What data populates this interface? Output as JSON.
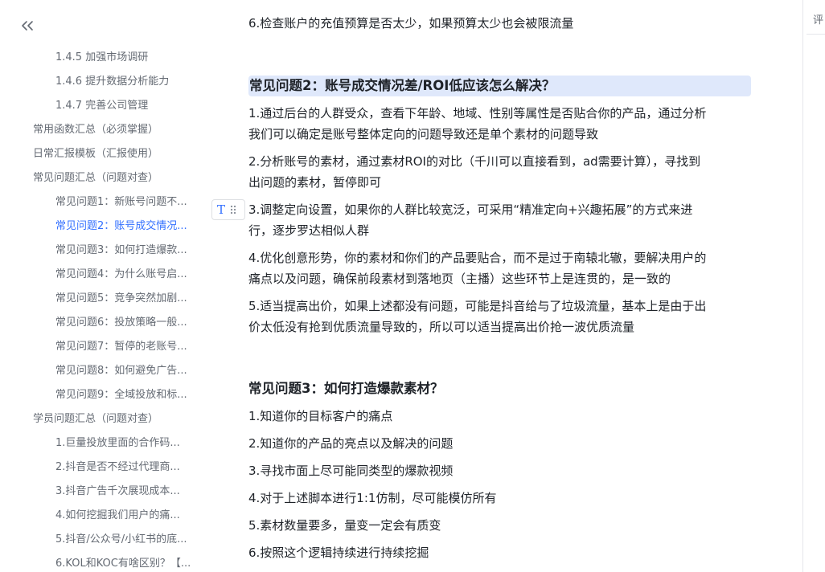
{
  "toc": {
    "items": [
      {
        "label": "1.4.5 加强市场调研",
        "level": 3
      },
      {
        "label": "1.4.6 提升数据分析能力",
        "level": 3
      },
      {
        "label": "1.4.7 完善公司管理",
        "level": 3
      },
      {
        "label": "常用函数汇总（必须掌握）",
        "level": 2
      },
      {
        "label": "日常汇报模板（汇报使用）",
        "level": 2
      },
      {
        "label": "常见问题汇总（问题对查）",
        "level": 2
      },
      {
        "label": "常见问题1：新账号问题不...",
        "level": 3
      },
      {
        "label": "常见问题2：账号成交情况...",
        "level": 3,
        "active": true
      },
      {
        "label": "常见问题3：如何打造爆款...",
        "level": 3
      },
      {
        "label": "常见问题4：为什么账号启...",
        "level": 3
      },
      {
        "label": "常见问题5：竞争突然加剧...",
        "level": 3
      },
      {
        "label": "常见问题6：投放策略一般...",
        "level": 3
      },
      {
        "label": "常见问题7：暂停的老账号...",
        "level": 3
      },
      {
        "label": "常见问题8：如何避免广告...",
        "level": 3
      },
      {
        "label": "常见问题9：全域投放和标...",
        "level": 3
      },
      {
        "label": "学员问题汇总（问题对查）",
        "level": 2
      },
      {
        "label": "1.巨量投放里面的合作码...",
        "level": 3
      },
      {
        "label": "2.抖音是否不经过代理商...",
        "level": 3
      },
      {
        "label": "3.抖音广告千次展现成本...",
        "level": 3
      },
      {
        "label": "4.如何挖掘我们用户的痛...",
        "level": 3
      },
      {
        "label": "5.抖音/公众号/小红书的底...",
        "level": 3
      },
      {
        "label": "6.KOL和KOC有啥区别？【...",
        "level": 3
      }
    ]
  },
  "block_tool": {
    "type_glyph": "T"
  },
  "doc": {
    "top_line": "6.检查账户的充值预算是否太少，如果预算太少也会被限流量",
    "q2_heading": "常见问题2：账号成交情况差/ROI低应该怎么解决？",
    "q2_items": [
      {
        "l1": "1.通过后台的人群受众，查看下年龄、地域、性别等属性是否贴合你的产品，通过分析",
        "l2": "我们可以确定是账号整体定向的问题导致还是单个素材的问题导致"
      },
      {
        "l1": "2.分析账号的素材，通过素材ROI的对比（千川可以直接看到，ad需要计算），寻找到",
        "l2": "出问题的素材，暂停即可"
      },
      {
        "l1": "3.调整定向设置，如果你的人群比较宽泛，可采用“精准定向+兴趣拓展”的方式来进",
        "l2": "行，逐步罗达相似人群"
      },
      {
        "l1": "4.优化创意形势，你的素材和你们的产品要贴合，而不是过于南辕北辙，要解决用户的",
        "l2": "痛点以及问题，确保前段素材到落地页（主播）这些环节上是连贯的，是一致的"
      },
      {
        "l1": "5.适当提高出价，如果上述都没有问题，可能是抖音给与了垃圾流量，基本上是由于出",
        "l2": "价太低没有抢到优质流量导致的，所以可以适当提高出价抢一波优质流量"
      }
    ],
    "q3_heading": "常见问题3：如何打造爆款素材？",
    "q3_items": [
      "1.知道你的目标客户的痛点",
      "2.知道你的产品的亮点以及解决的问题",
      "3.寻找市面上尽可能同类型的爆款视频",
      "4.对于上述脚本进行1:1仿制，尽可能模仿所有",
      "5.素材数量要多，量变一定会有质变",
      "6.按照这个逻辑持续进行持续挖掘"
    ]
  },
  "rightbar": {
    "tab_label": "评"
  }
}
